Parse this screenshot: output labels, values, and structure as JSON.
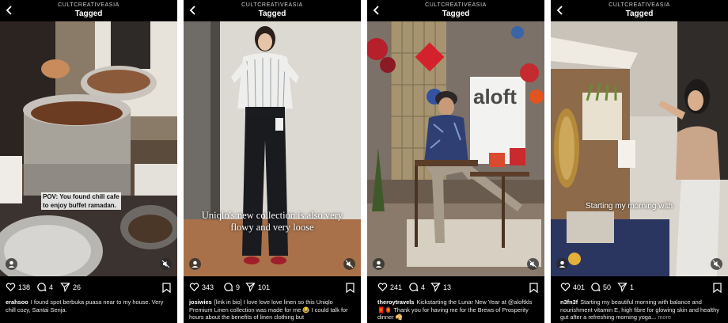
{
  "account": "CULTCREATIVEASIA",
  "page_title": "Tagged",
  "icons": {
    "back": "chevron-left-icon",
    "like": "heart-icon",
    "comment": "comment-bubble-icon",
    "share": "paper-plane-icon",
    "save": "bookmark-icon",
    "user_tag": "person-icon",
    "audio": "muted-speaker-icon"
  },
  "posts": [
    {
      "overlay_text": "POV: You found chill cafe\nto enjoy buffet ramadan.",
      "likes": "138",
      "comments": "4",
      "shares": "26",
      "handle": "erahsoo",
      "caption": "I found spot berbuka puasa near to my house. Very chill cozy, Santai Senja."
    },
    {
      "overlay_text": "Uniqlo's new collection is also very\nflowy and very loose",
      "likes": "343",
      "comments": "9",
      "shares": "101",
      "handle": "josiwies",
      "caption": "[link in bio] I love love love linen so this Uniqlo Premium Linen collection was made for me 😂 I could talk for hours about the benefits of linen clothing but"
    },
    {
      "overlay_text": "",
      "sign_text": "aloft",
      "likes": "241",
      "comments": "4",
      "shares": "13",
      "handle": "theroytravels",
      "caption": "Kickstarting the Lunar New Year at @aloftkls 🧧🏮 Thank you for having me for the Brews of Prosperity dinner 🥠"
    },
    {
      "overlay_text": "Starting my morning with",
      "likes": "401",
      "comments": "50",
      "shares": "1",
      "handle": "n3fn3f",
      "caption": "Starting my beautiful morning with balance and nourishment vitamin E, high fibre for glowing skin and healthy gut after a refreshing morning yoga...",
      "more": "more"
    }
  ]
}
